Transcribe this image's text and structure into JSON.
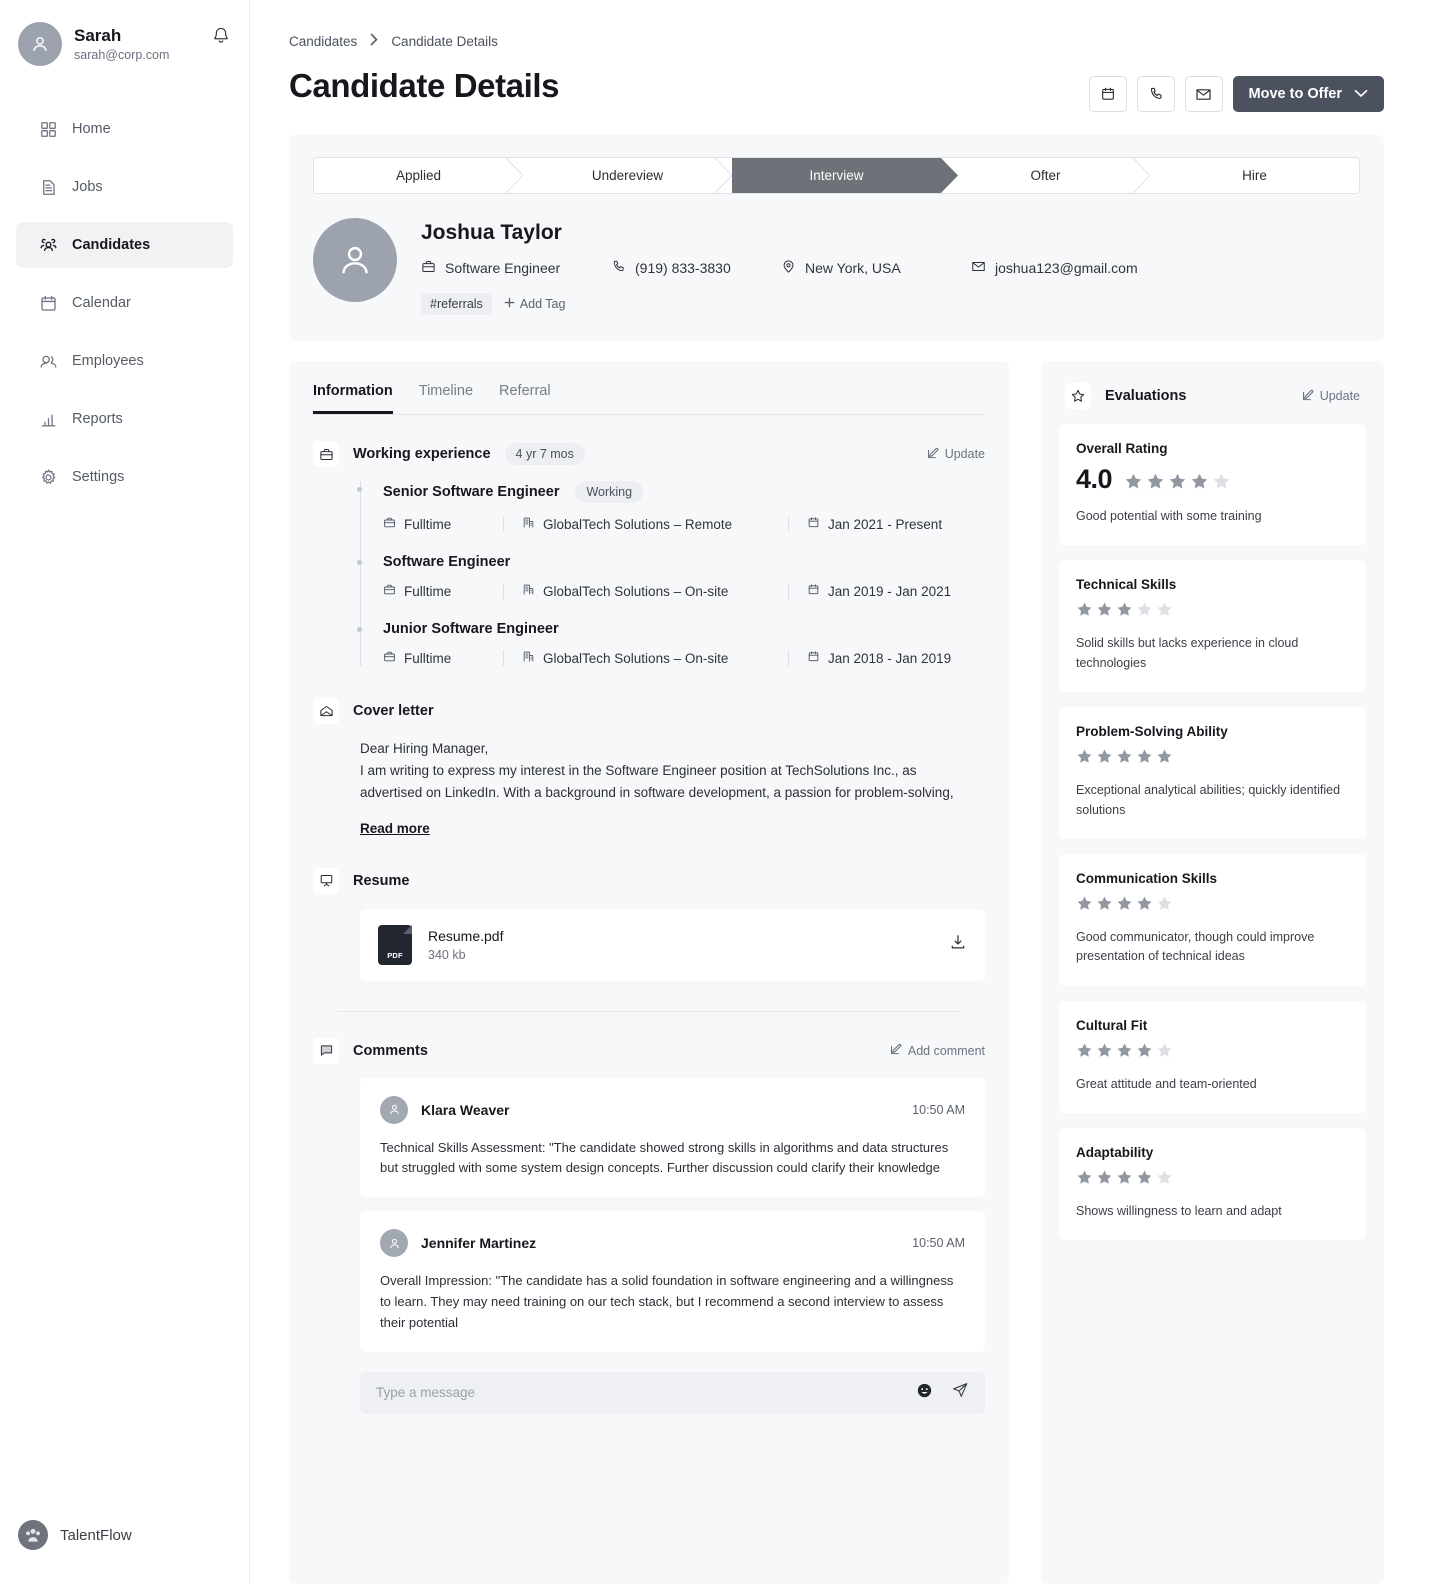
{
  "sidebar": {
    "user": {
      "name": "Sarah",
      "email": "sarah@corp.com"
    },
    "notification_icon": "bell-icon",
    "items": [
      {
        "label": "Home",
        "icon": "grid-icon",
        "active": false
      },
      {
        "label": "Jobs",
        "icon": "document-icon",
        "active": false
      },
      {
        "label": "Candidates",
        "icon": "users-icon",
        "active": true
      },
      {
        "label": "Calendar",
        "icon": "calendar-icon",
        "active": false
      },
      {
        "label": "Employees",
        "icon": "people-icon",
        "active": false
      },
      {
        "label": "Reports",
        "icon": "bar-chart-icon",
        "active": false
      },
      {
        "label": "Settings",
        "icon": "gear-icon",
        "active": false
      }
    ],
    "brand": "TalentFlow"
  },
  "breadcrumb": {
    "parent": "Candidates",
    "separator": "›",
    "current": "Candidate Details"
  },
  "header": {
    "title": "Candidate Details",
    "actions": [
      {
        "name": "schedule-button",
        "icon": "calendar-icon"
      },
      {
        "name": "call-button",
        "icon": "phone-icon"
      },
      {
        "name": "email-button",
        "icon": "envelope-icon"
      }
    ],
    "primary_button": {
      "label": "Move to Offer",
      "chevron": "chevron-down-icon"
    }
  },
  "stepper": {
    "steps": [
      {
        "label": "Applied",
        "active": false
      },
      {
        "label": "Undereview",
        "active": false
      },
      {
        "label": "Interview",
        "active": true
      },
      {
        "label": "Ofter",
        "active": false
      },
      {
        "label": "Hire",
        "active": false
      }
    ],
    "active_color": "#6d7178"
  },
  "candidate": {
    "name": "Joshua Taylor",
    "role": "Software Engineer",
    "phone": "(919) 833-3830",
    "location": "New York, USA",
    "email": "joshua123@gmail.com",
    "tags": [
      "#referrals"
    ],
    "add_tag_label": "Add Tag"
  },
  "tabs": [
    {
      "label": "Information",
      "active": true
    },
    {
      "label": "Timeline",
      "active": false
    },
    {
      "label": "Referral",
      "active": false
    }
  ],
  "working_experience": {
    "title": "Working experience",
    "duration_badge": "4 yr 7 mos",
    "update_label": "Update",
    "jobs": [
      {
        "title": "Senior Software Engineer",
        "status": "Working",
        "type": "Fulltime",
        "company": "GlobalTech Solutions – Remote",
        "dates": "Jan 2021 - Present"
      },
      {
        "title": "Software Engineer",
        "status": "",
        "type": "Fulltime",
        "company": "GlobalTech Solutions – On-site",
        "dates": "Jan 2019 - Jan 2021"
      },
      {
        "title": "Junior Software Engineer",
        "status": "",
        "type": "Fulltime",
        "company": "GlobalTech Solutions – On-site",
        "dates": "Jan 2018 - Jan 2019"
      }
    ]
  },
  "cover_letter": {
    "title": "Cover letter",
    "line1": "Dear Hiring Manager,",
    "line2": "I am writing to express my interest in the Software Engineer position at TechSolutions Inc., as advertised on LinkedIn. With a background in software development, a passion for problem-solving,",
    "read_more": "Read more"
  },
  "resume": {
    "title": "Resume",
    "file_name": "Resume.pdf",
    "file_size": "340 kb",
    "badge_text": "PDF",
    "download_icon": "download-icon"
  },
  "comments": {
    "title": "Comments",
    "add_label": "Add comment",
    "items": [
      {
        "author": "Klara Weaver",
        "time": "10:50 AM",
        "text": "Technical Skills Assessment: \"The candidate showed strong skills in algorithms and data structures but struggled with some system design concepts. Further discussion could clarify their knowledge"
      },
      {
        "author": "Jennifer Martinez",
        "time": "10:50 AM",
        "text": "Overall Impression: \"The candidate has a solid foundation in software engineering and a willingness to learn. They may need training on our tech stack, but I recommend a second interview to assess their potential"
      }
    ],
    "composer_placeholder": "Type a message",
    "emoji_icon": "emoji-icon",
    "send_icon": "send-icon"
  },
  "evaluations": {
    "title": "Evaluations",
    "update_label": "Update",
    "overall": {
      "name": "Overall Rating",
      "score": "4.0",
      "stars": 4,
      "max_stars": 5,
      "note": "Good potential with some training"
    },
    "criteria": [
      {
        "name": "Technical Skills",
        "stars": 3,
        "max_stars": 5,
        "note": "Solid skills but lacks experience in cloud technologies"
      },
      {
        "name": "Problem-Solving Ability",
        "stars": 5,
        "max_stars": 5,
        "note": "Exceptional analytical abilities; quickly identified solutions"
      },
      {
        "name": "Communication Skills",
        "stars": 4,
        "max_stars": 5,
        "note": "Good communicator, though could improve presentation of technical ideas"
      },
      {
        "name": "Cultural Fit",
        "stars": 4,
        "max_stars": 5,
        "note": "Great attitude and team-oriented"
      },
      {
        "name": "Adaptability",
        "stars": 4,
        "max_stars": 5,
        "note": "Shows willingness to learn and adapt"
      }
    ],
    "star_filled_color": "#9298a2",
    "star_empty_color": "#dcdfe4"
  }
}
